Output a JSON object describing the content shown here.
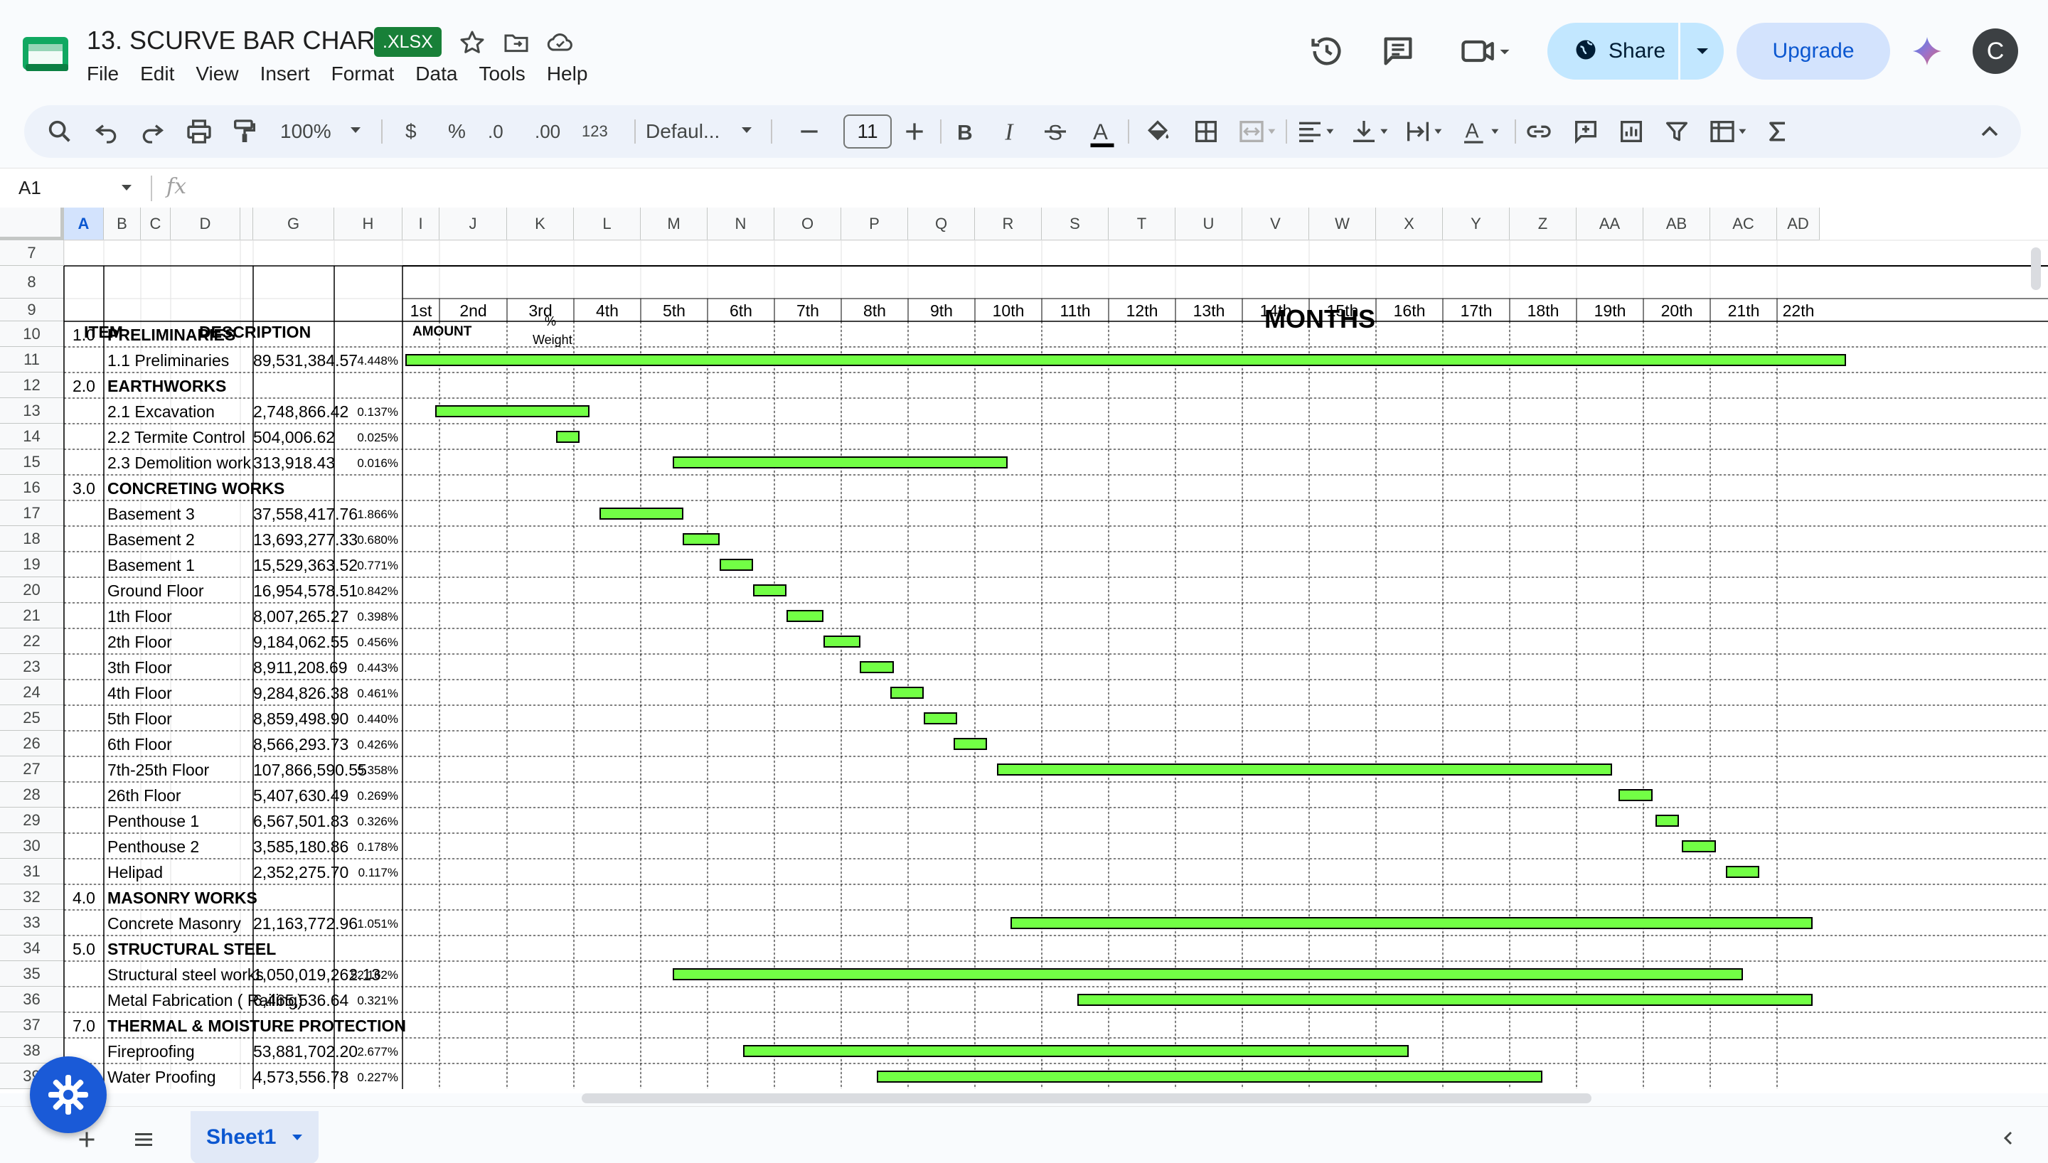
{
  "title_bar": {
    "doc_title": "13. SCURVE BAR CHART",
    "file_badge": ".XLSX",
    "menu": [
      "File",
      "Edit",
      "View",
      "Insert",
      "Format",
      "Data",
      "Tools",
      "Help"
    ],
    "share_label": "Share",
    "upgrade_label": "Upgrade",
    "avatar_letter": "C"
  },
  "toolbar": {
    "zoom": "100%",
    "currency": "$",
    "percent": "%",
    "decrease_decimal": ".0",
    "increase_decimal": ".00",
    "number_format": "123",
    "font": "Defaul...",
    "font_size": "11"
  },
  "formula_bar": {
    "cell_ref": "A1",
    "fx": "fx"
  },
  "columns": [
    "A",
    "B",
    "C",
    "D",
    "",
    "G",
    "H",
    "I",
    "J",
    "K",
    "L",
    "M",
    "N",
    "O",
    "P",
    "Q",
    "R",
    "S",
    "T",
    "U",
    "V",
    "W",
    "X",
    "Y",
    "Z",
    "AA",
    "AB",
    "AC",
    "AD"
  ],
  "rows": [
    "7",
    "8",
    "9",
    "10",
    "11",
    "12",
    "13",
    "14",
    "15",
    "16",
    "17",
    "18",
    "19",
    "20",
    "21",
    "22",
    "23",
    "24",
    "25",
    "26",
    "27",
    "28",
    "29",
    "30",
    "31",
    "32",
    "33",
    "34",
    "35",
    "36",
    "37",
    "38",
    "39"
  ],
  "sheet": {
    "headers": {
      "item": "ITEM",
      "description": "DESCRIPTION",
      "amount": "AMOUNT",
      "weight_line1": "%",
      "weight_line2": "Weight",
      "months": "MONTHS"
    },
    "months": [
      "1st",
      "2nd",
      "3rd",
      "4th",
      "5th",
      "6th",
      "7th",
      "8th",
      "9th",
      "10th",
      "11th",
      "12th",
      "13th",
      "14th",
      "15th",
      "16th",
      "17th",
      "18th",
      "19th",
      "20th",
      "21th",
      "22th"
    ],
    "lines": [
      {
        "row": 10,
        "item": "1.0",
        "desc": "PRELIMINARIES",
        "section": true
      },
      {
        "row": 11,
        "desc": "1.1 Preliminaries",
        "amount": "89,531,384.57",
        "weight": "4.448%",
        "start": 0,
        "end": 21.6
      },
      {
        "row": 12,
        "item": "2.0",
        "desc": "EARTHWORKS",
        "section": true
      },
      {
        "row": 13,
        "desc": "2.1 Excavation",
        "amount": "2,748,866.42",
        "weight": "0.137%",
        "start": 0.45,
        "end": 2.8
      },
      {
        "row": 14,
        "desc": "2.2 Termite Control",
        "amount": "504,006.62",
        "weight": "0.025%",
        "start": 2.25,
        "end": 2.65
      },
      {
        "row": 15,
        "desc": "2.3 Demolition work",
        "amount": "313,918.43",
        "weight": "0.016%",
        "start": 4.0,
        "end": 9.05
      },
      {
        "row": 16,
        "item": "3.0",
        "desc": "CONCRETING WORKS",
        "section": true
      },
      {
        "row": 17,
        "desc": "Basement 3",
        "amount": "37,558,417.76",
        "weight": "1.866%",
        "start": 2.9,
        "end": 4.2
      },
      {
        "row": 18,
        "desc": "Basement 2",
        "amount": "13,693,277.33",
        "weight": "0.680%",
        "start": 4.15,
        "end": 4.75
      },
      {
        "row": 19,
        "desc": "Basement 1",
        "amount": "15,529,363.52",
        "weight": "0.771%",
        "start": 4.7,
        "end": 5.25
      },
      {
        "row": 20,
        "desc": "Ground Floor",
        "amount": "16,954,578.51",
        "weight": "0.842%",
        "start": 5.2,
        "end": 5.75
      },
      {
        "row": 21,
        "desc": "1th Floor",
        "amount": "8,007,265.27",
        "weight": "0.398%",
        "start": 5.7,
        "end": 6.3
      },
      {
        "row": 22,
        "desc": "2th Floor",
        "amount": "9,184,062.55",
        "weight": "0.456%",
        "start": 6.25,
        "end": 6.85
      },
      {
        "row": 23,
        "desc": "3th Floor",
        "amount": "8,911,208.69",
        "weight": "0.443%",
        "start": 6.8,
        "end": 7.35
      },
      {
        "row": 24,
        "desc": "4th Floor",
        "amount": "9,284,826.38",
        "weight": "0.461%",
        "start": 7.25,
        "end": 7.8
      },
      {
        "row": 25,
        "desc": "5th Floor",
        "amount": "8,859,498.90",
        "weight": "0.440%",
        "start": 7.75,
        "end": 8.3
      },
      {
        "row": 26,
        "desc": "6th Floor",
        "amount": "8,566,293.73",
        "weight": "0.426%",
        "start": 8.2,
        "end": 8.75
      },
      {
        "row": 27,
        "desc": "7th-25th Floor",
        "amount": "107,866,590.55",
        "weight": "5.358%",
        "start": 8.85,
        "end": 18.1
      },
      {
        "row": 28,
        "desc": "26th Floor",
        "amount": "5,407,630.49",
        "weight": "0.269%",
        "start": 18.15,
        "end": 18.7
      },
      {
        "row": 29,
        "desc": "Penthouse 1",
        "amount": "6,567,501.83",
        "weight": "0.326%",
        "start": 18.7,
        "end": 19.1
      },
      {
        "row": 30,
        "desc": "Penthouse 2",
        "amount": "3,585,180.86",
        "weight": "0.178%",
        "start": 19.1,
        "end": 19.65
      },
      {
        "row": 31,
        "desc": "Helipad",
        "amount": "2,352,275.70",
        "weight": "0.117%",
        "start": 19.75,
        "end": 20.3
      },
      {
        "row": 32,
        "item": "4.0",
        "desc": "MASONRY WORKS",
        "section": true
      },
      {
        "row": 33,
        "desc": "Concrete Masonry",
        "amount": "21,163,772.96",
        "weight": "1.051%",
        "start": 9.05,
        "end": 21.1
      },
      {
        "row": 34,
        "item": "5.0",
        "desc": "STRUCTURAL STEEL",
        "section": true
      },
      {
        "row": 35,
        "desc": "Structural steel works",
        "amount": "1,050,019,262.13",
        "weight": "52.162%",
        "start": 4.0,
        "end": 20.05
      },
      {
        "row": 36,
        "desc": "Metal Fabrication ( Railing)",
        "amount": "6,465,536.64",
        "weight": "0.321%",
        "start": 10.05,
        "end": 21.1
      },
      {
        "row": 37,
        "item": "7.0",
        "desc": "THERMAL & MOISTURE PROTECTION",
        "section": true
      },
      {
        "row": 38,
        "desc": " Fireproofing",
        "amount": "53,881,702.20",
        "weight": "2.677%",
        "start": 5.05,
        "end": 15.05
      },
      {
        "row": 39,
        "desc": " Water Proofing",
        "amount": "4,573,556.78",
        "weight": "0.227%",
        "start": 7.05,
        "end": 17.05
      }
    ]
  },
  "bottom_bar": {
    "sheet_tab": "Sheet1"
  }
}
